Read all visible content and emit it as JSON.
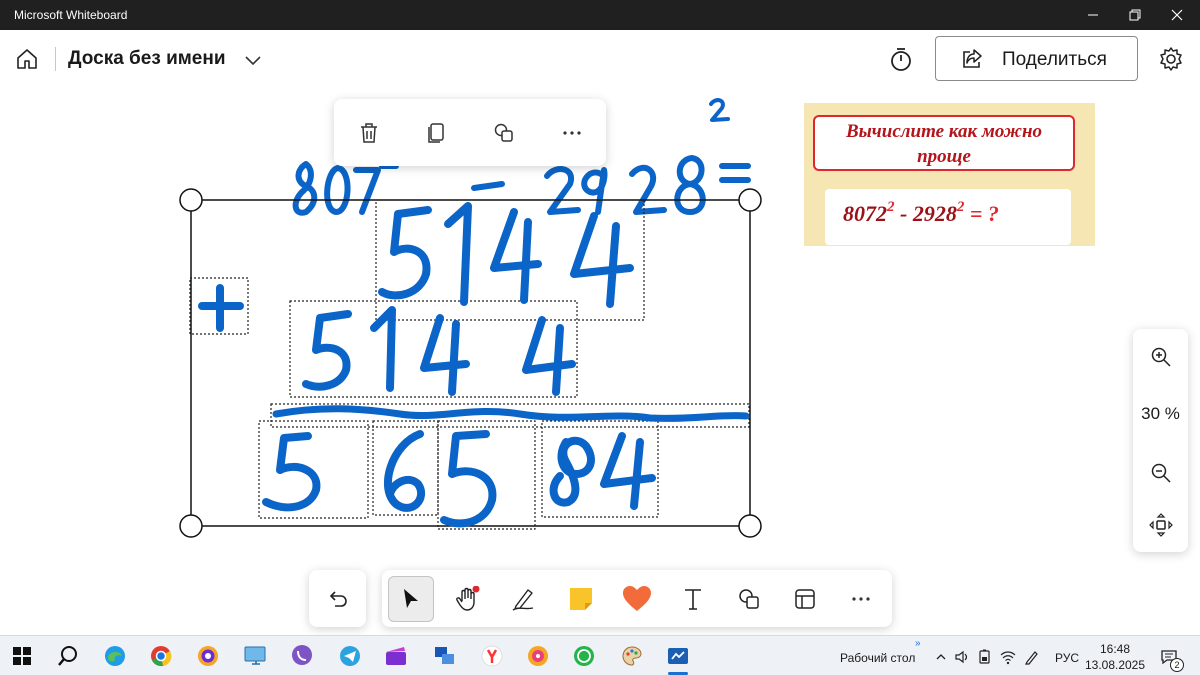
{
  "window": {
    "title": "Microsoft Whiteboard"
  },
  "header": {
    "board_title": "Доска без имени",
    "share_label": "Поделиться"
  },
  "problem": {
    "prompt_line1": "Вычислите как можно",
    "prompt_line2": "проще",
    "term1": "8072",
    "exp1": "2",
    "minus": "-",
    "term2": "2928",
    "exp2": "2",
    "tail": "= ?"
  },
  "zoom": {
    "level": "30 %"
  },
  "toolbar": {
    "tools": [
      "undo",
      "select",
      "hand",
      "pen",
      "sticky-note",
      "shape",
      "text",
      "copy-shapes",
      "template",
      "more"
    ],
    "active_tool": "select"
  },
  "taskbar": {
    "desktop_label": "Рабочий стол",
    "language": "РУС",
    "time": "16:48",
    "date": "13.08.2025",
    "notifications": "2"
  },
  "colors": {
    "ink": "#0b64c7",
    "accent": "#1a6fd1",
    "card_bg": "#f5e6b4",
    "card_border": "#e0262e"
  }
}
